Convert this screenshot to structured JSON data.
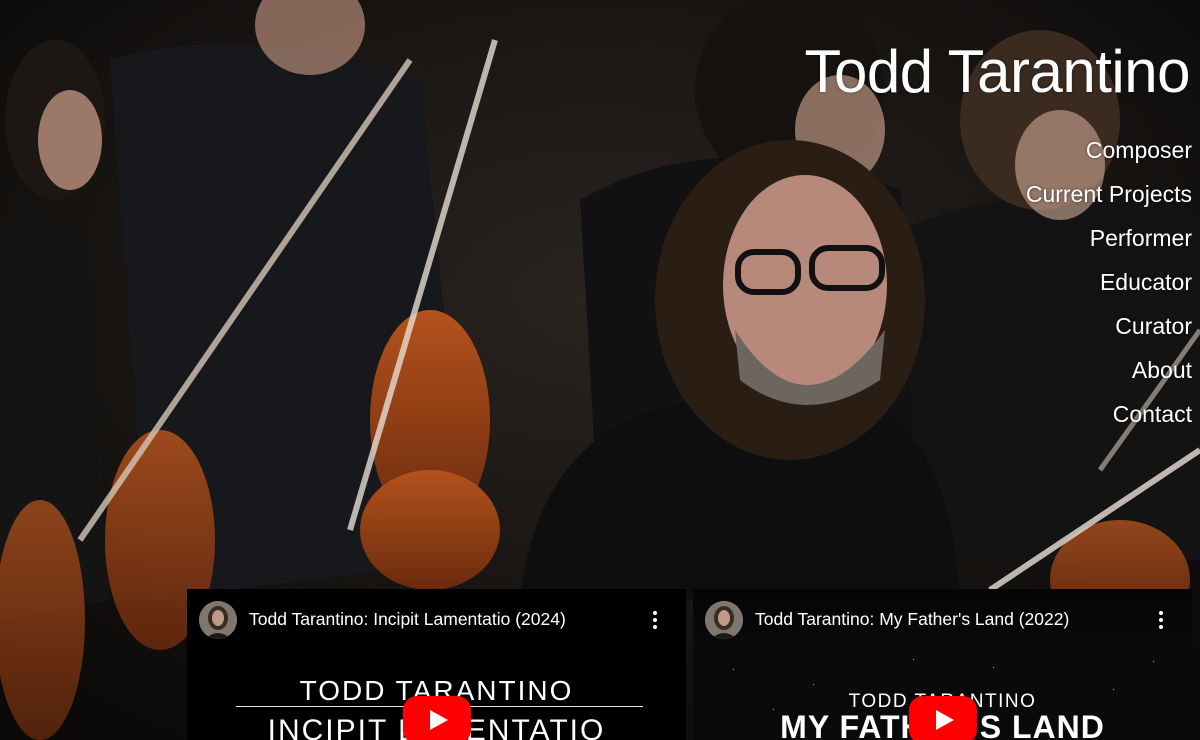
{
  "site": {
    "title": "Todd Tarantino"
  },
  "nav": {
    "items": [
      {
        "label": "Composer"
      },
      {
        "label": "Current Projects"
      },
      {
        "label": "Performer"
      },
      {
        "label": "Educator"
      },
      {
        "label": "Curator"
      },
      {
        "label": "About"
      },
      {
        "label": "Contact"
      }
    ]
  },
  "videos": [
    {
      "title": "Todd Tarantino: Incipit Lamentatio (2024)",
      "cover_line1": "TODD TARANTINO",
      "cover_line2": "INCIPIT LAMENTATIO"
    },
    {
      "title": "Todd Tarantino: My Father's Land (2022)",
      "cover_line1": "TODD TARANTINO",
      "cover_line2": "MY FATHER'S LAND"
    }
  ],
  "colors": {
    "text": "#ffffff",
    "play_button": "#ff0000",
    "background": "#0d0c0b"
  },
  "icons": {
    "menu": "kebab-menu-icon",
    "play": "youtube-play-icon"
  }
}
